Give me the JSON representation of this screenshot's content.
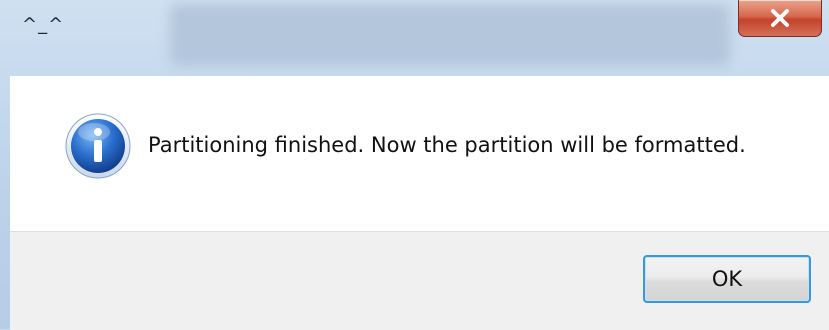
{
  "dialog": {
    "title": "^_^",
    "message": "Partitioning finished. Now the partition will be formatted.",
    "ok_label": "OK",
    "icon": "info-icon"
  },
  "titlebar": {
    "close_icon": "close-icon",
    "close_color": "#c3432b"
  },
  "colors": {
    "frame": "#bcd2ea",
    "content_bg": "#ffffff",
    "footer_bg": "#f0f0f0",
    "button_border": "#3c97d6",
    "info_icon_blue": "#1f5fb8"
  }
}
